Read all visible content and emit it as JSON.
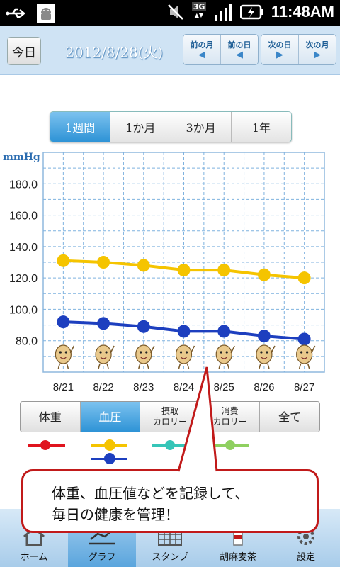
{
  "status_bar": {
    "time": "11:48AM",
    "network": "3G"
  },
  "header": {
    "today_label": "今日",
    "date": "2012/8/28(火)",
    "nav": [
      {
        "label": "前の月",
        "arrow": "◀"
      },
      {
        "label": "前の日",
        "arrow": "◀"
      },
      {
        "label": "次の日",
        "arrow": "▶"
      },
      {
        "label": "次の月",
        "arrow": "▶"
      }
    ]
  },
  "periods": [
    {
      "label": "1週間",
      "active": true
    },
    {
      "label": "1か月",
      "active": false
    },
    {
      "label": "3か月",
      "active": false
    },
    {
      "label": "1年",
      "active": false
    }
  ],
  "chart_data": {
    "type": "line",
    "ylabel": "mmHg",
    "x": [
      "8/21",
      "8/22",
      "8/23",
      "8/24",
      "8/25",
      "8/26",
      "8/27"
    ],
    "ylim": [
      60,
      200
    ],
    "yticks": [
      "180.0",
      "160.0",
      "140.0",
      "120.0",
      "100.0",
      "80.0"
    ],
    "grid": true,
    "series": [
      {
        "color": "#f5c400",
        "values": [
          131,
          130,
          128,
          125,
          125,
          122,
          120
        ]
      },
      {
        "color": "#1d3fbf",
        "values": [
          92,
          91,
          89,
          86,
          86,
          83,
          81
        ]
      }
    ]
  },
  "data_tabs": [
    {
      "label": "体重",
      "active": false
    },
    {
      "label": "血圧",
      "active": true
    },
    {
      "label": "摂取カロリー",
      "line1": "摂取",
      "line2": "カロリー",
      "active": false
    },
    {
      "label": "消費カロリー",
      "line1": "消費",
      "line2": "カロリー",
      "active": false
    },
    {
      "label": "全て",
      "active": false
    }
  ],
  "legend_colors": [
    "#e0141e",
    "#f5c400",
    "#1d3fbf",
    "#35c5b8",
    "#8fd060"
  ],
  "callout": {
    "line1": "体重、血圧値などを記録して、",
    "line2": "毎日の健康を管理！",
    "border_color": "#c11a1a"
  },
  "bottom_nav": [
    {
      "label": "ホーム",
      "icon": "home-icon",
      "active": false
    },
    {
      "label": "グラフ",
      "icon": "graph-icon",
      "active": true
    },
    {
      "label": "スタンプ",
      "icon": "stamp-icon",
      "active": false
    },
    {
      "label": "胡麻麦茶",
      "icon": "tea-icon",
      "active": false
    },
    {
      "label": "設定",
      "icon": "settings-icon",
      "active": false
    }
  ]
}
